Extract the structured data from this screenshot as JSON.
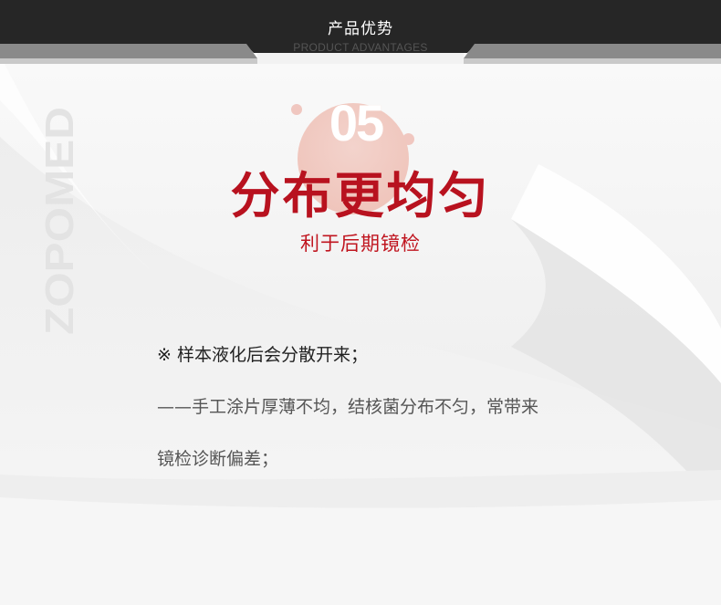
{
  "header": {
    "title": "产品优势",
    "subtitle": "PRODUCT ADVANTAGES"
  },
  "side_brand": {
    "text": "ZOPOMED"
  },
  "feature": {
    "number": "05",
    "title": "分布更均匀",
    "subtitle": "利于后期镜检"
  },
  "description": {
    "line1": "※ 样本液化后会分散开来；",
    "line2": "——手工涂片厚薄不均，结核菌分布不匀，常带来",
    "line3": "镜检诊断偏差；"
  },
  "colors": {
    "accent_red": "#b8121f",
    "header_bg": "#262626",
    "number_circle": "#eec0b6"
  }
}
